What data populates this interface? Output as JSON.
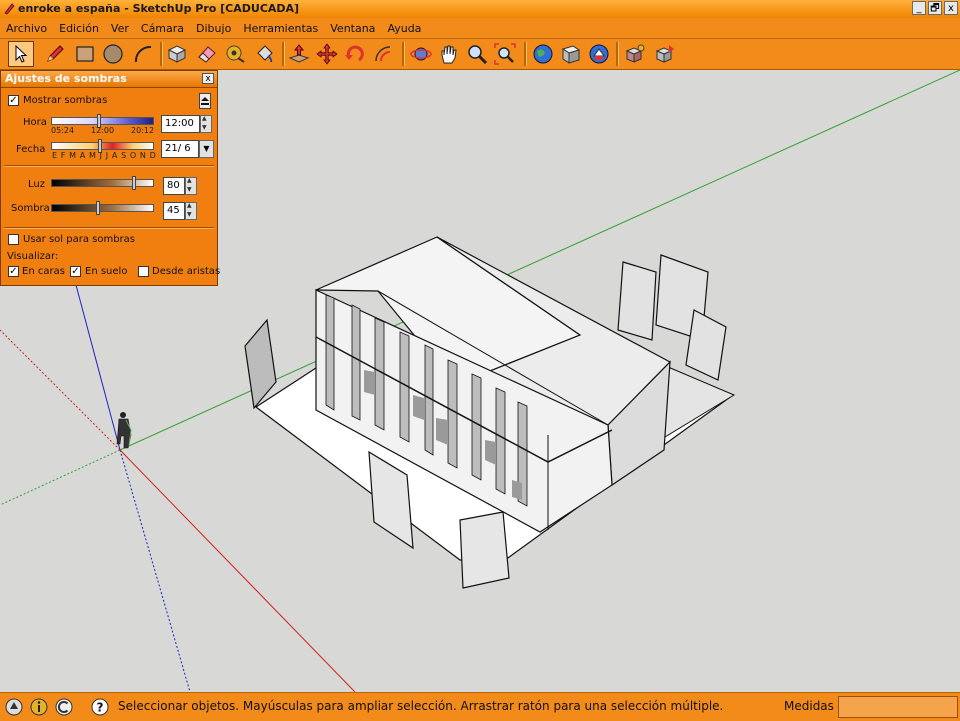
{
  "window": {
    "title": "enroke a españa - SketchUp Pro [CADUCADA]",
    "buttons": [
      "_",
      "🗗",
      "x"
    ]
  },
  "menu": [
    "Archivo",
    "Edición",
    "Ver",
    "Cámara",
    "Dibujo",
    "Herramientas",
    "Ventana",
    "Ayuda"
  ],
  "toolbar": {
    "tools": [
      "select-icon",
      "pencil-icon",
      "rectangle-icon",
      "circle-icon",
      "arc-icon",
      "eraser-box-icon",
      "eraser-icon",
      "tape-measure-icon",
      "paint-bucket-icon",
      "push-pull-icon",
      "move-icon",
      "rotate-icon",
      "offset-icon",
      "orbit-icon",
      "pan-icon",
      "zoom-icon",
      "zoom-extents-icon",
      "google-earth-icon",
      "model-library-icon",
      "warehouse-icon",
      "component-icon",
      "share-icon"
    ]
  },
  "shadow_panel": {
    "title": "Ajustes de sombras",
    "close": "x",
    "show_shadows_label": "Mostrar sombras",
    "show_shadows_checked": true,
    "hora_label": "Hora",
    "hora_ticks": [
      "05:24",
      "12:00",
      "20:12"
    ],
    "hora_value": "12:00",
    "fecha_label": "Fecha",
    "fecha_ticks": "E F M A M J J A S O N D",
    "fecha_value": "21/ 6",
    "luz_label": "Luz",
    "luz_value": "80",
    "sombra_label": "Sombra",
    "sombra_value": "45",
    "use_sun_label": "Usar sol para sombras",
    "use_sun_checked": false,
    "visualizar_label": "Visualizar:",
    "en_caras_label": "En caras",
    "en_caras_checked": true,
    "en_suelo_label": "En suelo",
    "en_suelo_checked": true,
    "desde_aristas_label": "Desde aristas",
    "desde_aristas_checked": false
  },
  "status": {
    "message": "Seleccionar objetos. Mayúsculas para ampliar selección. Arrastrar ratón para una selección múltiple.",
    "measures_label": "Medidas",
    "measures_value": ""
  },
  "colors": {
    "accent": "#f38b1a",
    "axis_red": "#d02020",
    "axis_green": "#20b020",
    "axis_blue": "#2020d0"
  }
}
